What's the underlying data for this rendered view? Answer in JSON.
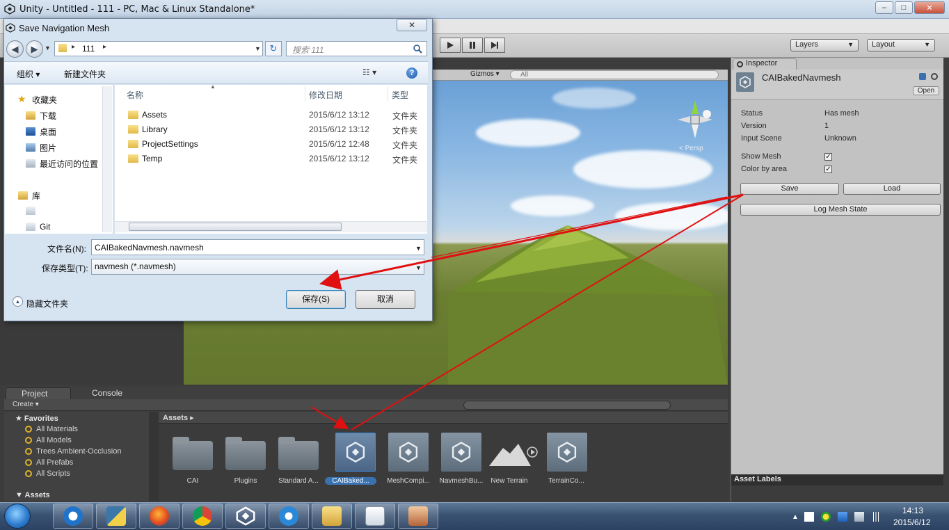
{
  "unity_window": {
    "title": "Unity - Untitled - 111 - PC, Mac & Linux Standalone*",
    "toolbar": {
      "layers_label": "Layers",
      "layout_label": "Layout"
    },
    "scene": {
      "gizmos_label": "Gizmos",
      "search_placeholder": "All",
      "persp_label": "Persp"
    }
  },
  "inspector": {
    "tab_label": "Inspector",
    "asset_name": "CAIBakedNavmesh",
    "open_label": "Open",
    "properties": [
      {
        "label": "Status",
        "value": "Has mesh"
      },
      {
        "label": "Version",
        "value": "1"
      },
      {
        "label": "Input Scene",
        "value": "Unknown"
      }
    ],
    "toggles": [
      {
        "label": "Show Mesh",
        "checked": true
      },
      {
        "label": "Color by area",
        "checked": true
      }
    ],
    "save_label": "Save",
    "load_label": "Load",
    "log_label": "Log Mesh State",
    "asset_labels_title": "Asset Labels"
  },
  "project": {
    "project_tab": "Project",
    "console_tab": "Console",
    "create_label": "Create",
    "favorites_title": "Favorites",
    "favorites": [
      "All Materials",
      "All Models",
      "Trees Ambient-Occlusion",
      "All Prefabs",
      "All Scripts"
    ],
    "assets_tree_title": "Assets",
    "breadcrumb": "Assets",
    "assets": [
      {
        "name": "CAI",
        "kind": "folder"
      },
      {
        "name": "Plugins",
        "kind": "folder"
      },
      {
        "name": "Standard A...",
        "kind": "folder"
      },
      {
        "name": "CAIBaked...",
        "kind": "unity",
        "selected": true
      },
      {
        "name": "MeshCompi...",
        "kind": "unity"
      },
      {
        "name": "NavmeshBu...",
        "kind": "unity"
      },
      {
        "name": "New Terrain",
        "kind": "terrain"
      },
      {
        "name": "TerrainCo...",
        "kind": "unity"
      }
    ]
  },
  "dialog": {
    "title": "Save Navigation Mesh",
    "address": "111",
    "search_placeholder": "搜索 111",
    "organize_label": "组织",
    "new_folder_label": "新建文件夹",
    "nav": {
      "favorites_label": "收藏夹",
      "items": [
        "下载",
        "桌面",
        "图片",
        "最近访问的位置"
      ],
      "library_label": "库",
      "git_label": "Git"
    },
    "columns": {
      "name": "名称",
      "date": "修改日期",
      "type": "类型"
    },
    "files": [
      {
        "name": "Assets",
        "date": "2015/6/12 13:12",
        "type": "文件夹"
      },
      {
        "name": "Library",
        "date": "2015/6/12 13:12",
        "type": "文件夹"
      },
      {
        "name": "ProjectSettings",
        "date": "2015/6/12 12:48",
        "type": "文件夹"
      },
      {
        "name": "Temp",
        "date": "2015/6/12 13:12",
        "type": "文件夹"
      }
    ],
    "filename_label": "文件名(N):",
    "filename_value": "CAIBakedNavmesh.navmesh",
    "filetype_label": "保存类型(T):",
    "filetype_value": "navmesh (*.navmesh)",
    "save_button": "保存(S)",
    "cancel_button": "取消",
    "hide_folders_label": "隐藏文件夹"
  },
  "taskbar": {
    "time": "14:13",
    "date": "2015/6/12"
  },
  "colors": {
    "annotation_arrow": "#e01010",
    "unity_dark_panel": "#3c3c3c",
    "inspector_bg": "#c2c2c2",
    "selection_blue": "#3a72b0"
  }
}
